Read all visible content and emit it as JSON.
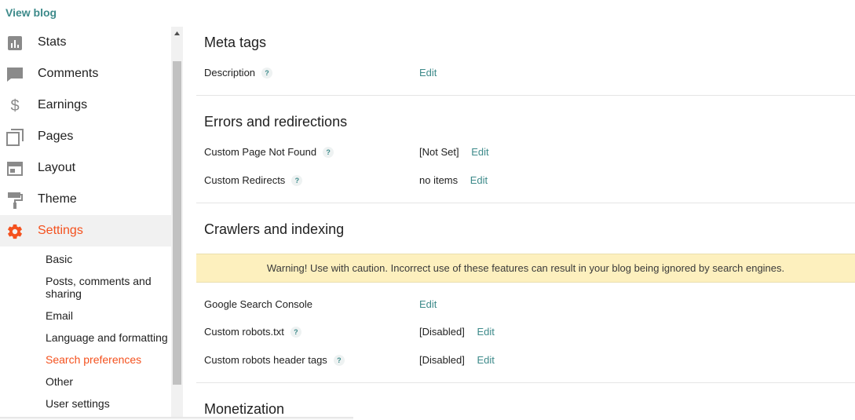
{
  "header": {
    "view_blog": "View blog"
  },
  "sidebar": {
    "items": [
      {
        "label": "Stats",
        "icon": "stats-icon"
      },
      {
        "label": "Comments",
        "icon": "comment-icon"
      },
      {
        "label": "Earnings",
        "icon": "dollar-icon"
      },
      {
        "label": "Pages",
        "icon": "pages-icon"
      },
      {
        "label": "Layout",
        "icon": "layout-icon"
      },
      {
        "label": "Theme",
        "icon": "paint-roller-icon"
      },
      {
        "label": "Settings",
        "icon": "gear-icon",
        "active": true
      }
    ],
    "subitems": [
      {
        "label": "Basic"
      },
      {
        "label": "Posts, comments and sharing"
      },
      {
        "label": "Email"
      },
      {
        "label": "Language and formatting"
      },
      {
        "label": "Search preferences",
        "active": true
      },
      {
        "label": "Other"
      },
      {
        "label": "User settings"
      }
    ]
  },
  "main": {
    "meta": {
      "title": "Meta tags",
      "description_label": "Description",
      "description_edit": "Edit"
    },
    "errors": {
      "title": "Errors and redirections",
      "not_found_label": "Custom Page Not Found",
      "not_found_value": "[Not Set]",
      "not_found_edit": "Edit",
      "redirects_label": "Custom Redirects",
      "redirects_value": "no items",
      "redirects_edit": "Edit"
    },
    "crawlers": {
      "title": "Crawlers and indexing",
      "warning": "Warning! Use with caution. Incorrect use of these features can result in your blog being ignored by search engines.",
      "console_label": "Google Search Console",
      "console_edit": "Edit",
      "robots_label": "Custom robots.txt",
      "robots_value": "[Disabled]",
      "robots_edit": "Edit",
      "header_tags_label": "Custom robots header tags",
      "header_tags_value": "[Disabled]",
      "header_tags_edit": "Edit"
    },
    "monetization": {
      "title": "Monetization"
    },
    "help_glyph": "?"
  },
  "colors": {
    "accent": "#f4511e",
    "link": "#3d8a8a",
    "warning_bg": "#fdf0be"
  }
}
